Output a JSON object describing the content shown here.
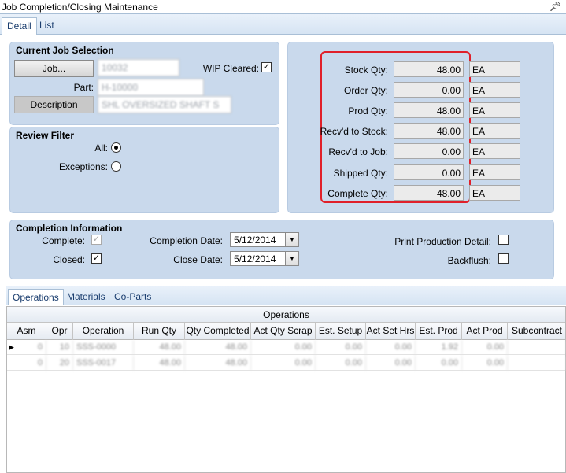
{
  "window": {
    "title": "Job Completion/Closing Maintenance",
    "pin_icon": "pin-icon"
  },
  "tabs": [
    {
      "label": "Detail"
    },
    {
      "label": "List"
    }
  ],
  "job_selection": {
    "title": "Current Job Selection",
    "job_button": "Job...",
    "job_value": "10032",
    "wip_cleared_label": "WIP Cleared:",
    "wip_cleared_checked": true,
    "part_label": "Part:",
    "part_value": "H-10000",
    "description_button": "Description",
    "description_value": "SHL OVERSIZED SHAFT S"
  },
  "review_filter": {
    "title": "Review Filter",
    "all_label": "All:",
    "exceptions_label": "Exceptions:",
    "selected": "All"
  },
  "quantities": [
    {
      "label": "Stock Qty:",
      "value": "48.00",
      "uom": "EA"
    },
    {
      "label": "Order Qty:",
      "value": "0.00",
      "uom": "EA"
    },
    {
      "label": "Prod Qty:",
      "value": "48.00",
      "uom": "EA"
    },
    {
      "label": "Recv'd to Stock:",
      "value": "48.00",
      "uom": "EA"
    },
    {
      "label": "Recv'd to Job:",
      "value": "0.00",
      "uom": "EA"
    },
    {
      "label": "Shipped Qty:",
      "value": "0.00",
      "uom": "EA"
    },
    {
      "label": "Complete Qty:",
      "value": "48.00",
      "uom": "EA"
    }
  ],
  "completion": {
    "title": "Completion Information",
    "complete_label": "Complete:",
    "complete_checked": true,
    "closed_label": "Closed:",
    "closed_checked": true,
    "completion_date_label": "Completion Date:",
    "completion_date": "5/12/2014",
    "close_date_label": "Close Date:",
    "close_date": "5/12/2014",
    "print_detail_label": "Print Production Detail:",
    "backflush_label": "Backflush:"
  },
  "subtabs": [
    {
      "label": "Operations"
    },
    {
      "label": "Materials"
    },
    {
      "label": "Co-Parts"
    }
  ],
  "operations_grid": {
    "caption": "Operations",
    "columns": [
      "Asm",
      "Opr",
      "Operation",
      "Run Qty",
      "Qty Completed",
      "Act Qty Scrap",
      "Est. Setup",
      "Act Set Hrs",
      "Est. Prod",
      "Act Prod",
      "Subcontract"
    ],
    "rows": [
      [
        "0",
        "10",
        "SSS-0000",
        "48.00",
        "48.00",
        "0.00",
        "0.00",
        "0.00",
        "1.92",
        "0.00",
        ""
      ],
      [
        "0",
        "20",
        "SSS-0017",
        "48.00",
        "48.00",
        "0.00",
        "0.00",
        "0.00",
        "0.00",
        "0.00",
        ""
      ]
    ]
  },
  "colors": {
    "panel": "#c9d9ec",
    "highlight_border": "#e0202a",
    "tab_text": "#1a3d6e"
  }
}
